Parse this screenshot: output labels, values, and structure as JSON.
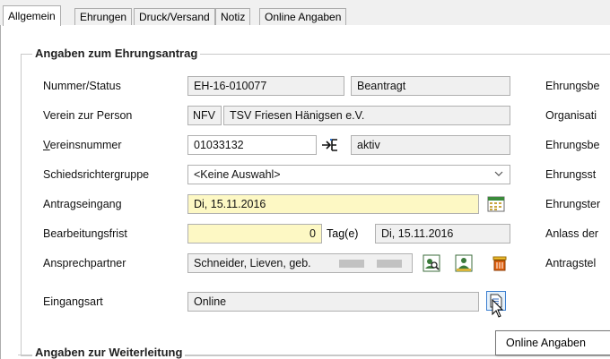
{
  "tabs": [
    {
      "label": "Allgemein",
      "active": true
    },
    {
      "label": "Ehrungen"
    },
    {
      "label": "Druck/Versand"
    },
    {
      "label": "Notiz"
    },
    {
      "label": "Online Angaben"
    }
  ],
  "section_main": {
    "title": "Angaben zum Ehrungsantrag"
  },
  "section_forward": {
    "title": "Angaben zur Weiterleitung"
  },
  "rows": {
    "nummer_status": {
      "label": "Nummer/Status",
      "number": "EH-16-010077",
      "status": "Beantragt"
    },
    "verein": {
      "label": "Verein zur Person",
      "short": "NFV",
      "name": "TSV Friesen Hänigsen e.V."
    },
    "vereinsnummer": {
      "label_first": "V",
      "label_rest": "ereinsnummer",
      "value": "01033132",
      "status": "aktiv"
    },
    "schiedsrichter": {
      "label": "Schiedsrichtergruppe",
      "value": "<Keine Auswahl>"
    },
    "antragseingang": {
      "label": "Antragseingang",
      "value": "Di, 15.11.2016"
    },
    "bearbeitungsfrist": {
      "label": "Bearbeitungsfrist",
      "days": "0",
      "unit": "Tag(e)",
      "date": "Di, 15.11.2016"
    },
    "ansprechpartner": {
      "label": "Ansprechpartner",
      "value": "Schneider, Lieven, geb."
    },
    "eingangsart": {
      "label": "Eingangsart",
      "value": "Online"
    }
  },
  "right_labels": [
    "Ehrungsbe",
    "Organisati",
    "Ehrungsbe",
    "Ehrungsst",
    "Ehrungster",
    "Anlass der",
    "Antragstel"
  ],
  "tooltip": {
    "text": "Online Angaben"
  },
  "colors": {
    "yellow_field": "#fdf8c4",
    "border": "#b0b0b0",
    "panel": "#ffffff"
  },
  "icons": [
    "link-arrow-icon",
    "calendar-icon",
    "person-search-icon",
    "person-card-icon",
    "trash-icon",
    "document-icon",
    "chevron-down-icon",
    "mouse-cursor-icon"
  ]
}
